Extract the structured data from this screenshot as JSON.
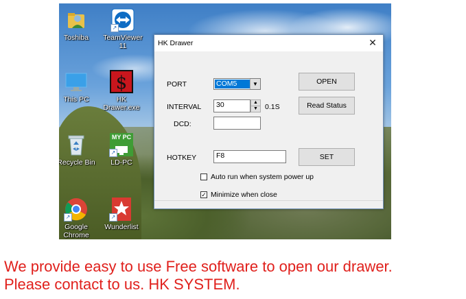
{
  "desktop": {
    "icons": [
      {
        "label": "Toshiba",
        "icon": "user-folder-icon"
      },
      {
        "label": "TeamViewer 11",
        "icon": "teamviewer-icon"
      },
      {
        "label": "This PC",
        "icon": "monitor-icon"
      },
      {
        "label": "HK Drawer.exe",
        "icon": "hk-drawer-app-icon"
      },
      {
        "label": "Recycle Bin",
        "icon": "recycle-bin-icon"
      },
      {
        "label": "LD-PC",
        "icon": "my-pc-icon",
        "badge": "MY PC"
      },
      {
        "label": "Google Chrome",
        "icon": "chrome-icon"
      },
      {
        "label": "Wunderlist",
        "icon": "wunderlist-icon"
      }
    ]
  },
  "dialog": {
    "title": "HK Drawer",
    "close_glyph": "✕",
    "port_label": "PORT",
    "port_value": "COM5",
    "interval_label": "INTERVAL",
    "interval_value": "30",
    "interval_unit": "0.1S",
    "dcd_label": "DCD:",
    "dcd_value": "",
    "hotkey_label": "HOTKEY",
    "hotkey_value": "F8",
    "open_button": "OPEN",
    "read_status_button": "Read Status",
    "set_button": "SET",
    "auto_run_label": "Auto run when system power up",
    "auto_run_checked": false,
    "minimize_label": "Minimize when close",
    "minimize_checked": true
  },
  "caption": {
    "line1": "We provide easy to use Free software to open our drawer.",
    "line2": "Please contact to us. HK SYSTEM."
  },
  "colors": {
    "caption": "#e0201c",
    "selection": "#0078d7"
  }
}
